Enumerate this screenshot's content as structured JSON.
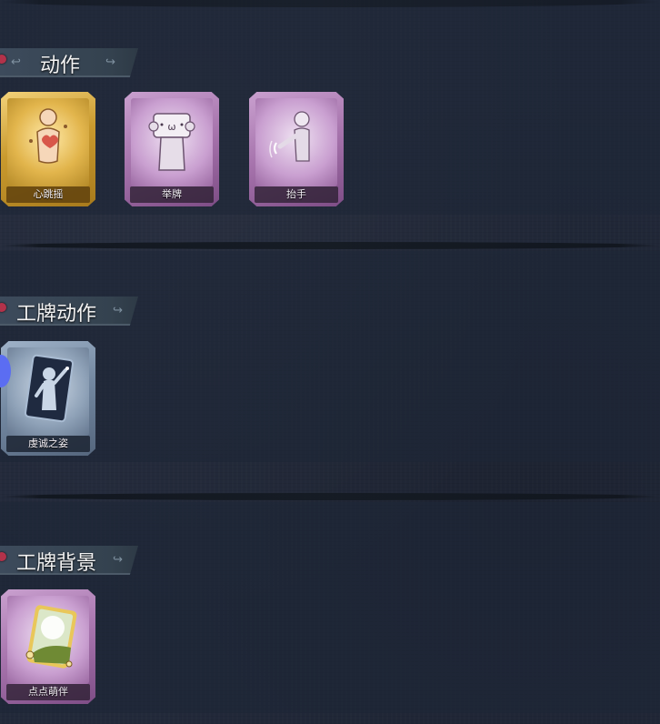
{
  "sections": [
    {
      "title": "动作",
      "items": [
        {
          "label": "心跳摇",
          "rarity": "gold",
          "icon": "heart-sway-icon"
        },
        {
          "label": "举牌",
          "rarity": "purple",
          "icon": "hold-sign-icon"
        },
        {
          "label": "抬手",
          "rarity": "purple",
          "icon": "raise-hand-icon"
        }
      ]
    },
    {
      "title": "工牌动作",
      "items": [
        {
          "label": "虔诚之姿",
          "rarity": "blue",
          "icon": "devout-pose-icon"
        }
      ]
    },
    {
      "title": "工牌背景",
      "items": [
        {
          "label": "点点萌伴",
          "rarity": "purple",
          "icon": "badge-background-icon"
        }
      ]
    }
  ],
  "colors": {
    "background": "#22293a",
    "gold": "#c99a2e",
    "purple": "#a673ac",
    "blue": "#7287a0",
    "indicator": "#5b6df2"
  }
}
